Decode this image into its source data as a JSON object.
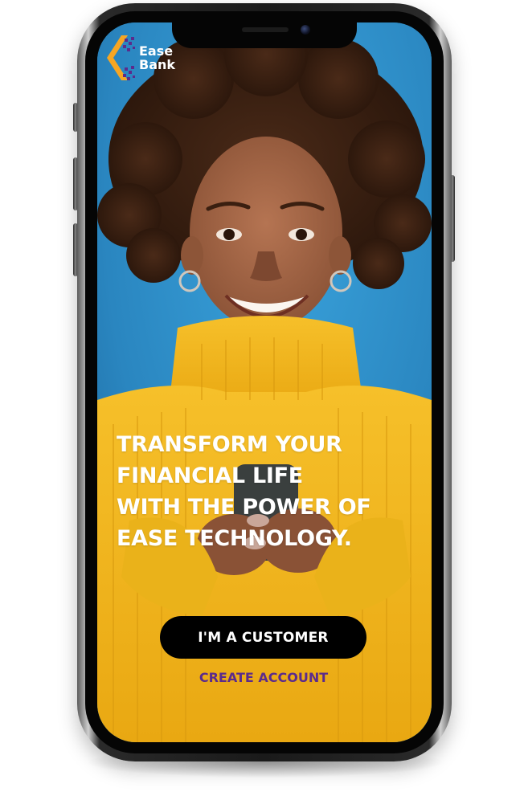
{
  "brand": {
    "name_line1": "Ease",
    "name_line2": "Bank",
    "colors": {
      "accent_orange": "#f6a623",
      "accent_purple": "#5b2b8c",
      "button_bg": "#000000",
      "button_text": "#ffffff"
    },
    "logo_icon": "ease-bank-logo-icon"
  },
  "hero": {
    "headline": "TRANSFORM YOUR FINANCIAL LIFE WITH THE POWER OF EASE TECHNOLOGY.",
    "background_color": "#2f8fc9",
    "sweater_color": "#f2b51a"
  },
  "actions": {
    "customer_button_label": "I'M A CUSTOMER",
    "create_account_label": "CREATE ACCOUNT"
  }
}
